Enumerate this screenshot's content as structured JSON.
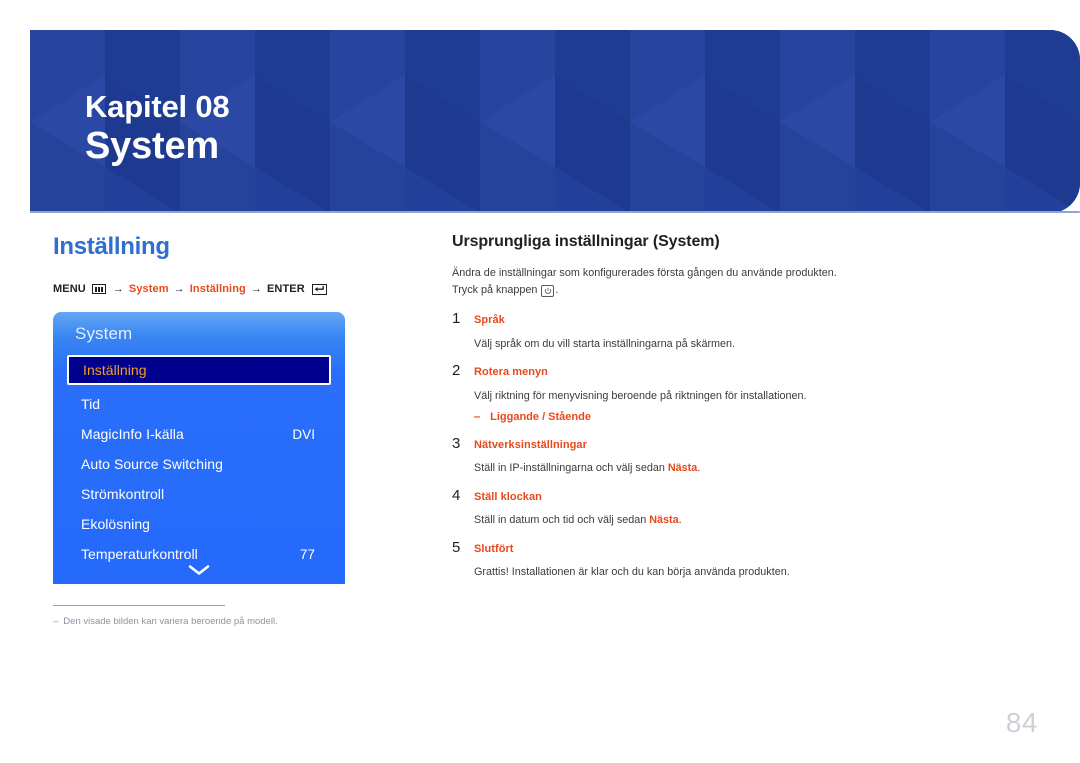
{
  "banner": {
    "kicker": "Kapitel 08",
    "title": "System",
    "bg_color": "#22409a"
  },
  "left": {
    "section_heading": "Inställning",
    "section_heading_color": "#2f6fd0",
    "menu_path": {
      "menu_label": "MENU",
      "menu_icon": "menu-grid-icon",
      "arrow": "→",
      "step1": "System",
      "step2": "Inställning",
      "enter_label": "ENTER",
      "enter_icon": "enter-return-icon",
      "highlight_color": "#e8481c"
    },
    "osd": {
      "title": "System",
      "selected_index": 0,
      "selected_bg": "#00008e",
      "selected_text_color": "#f0a022",
      "chevron_icon": "chevron-down-icon",
      "rows": [
        {
          "label": "Inställning",
          "value": "",
          "selected": true
        },
        {
          "label": "Tid",
          "value": "",
          "selected": false
        },
        {
          "label": "MagicInfo I-källa",
          "value": "DVI",
          "selected": false
        },
        {
          "label": "Auto Source Switching",
          "value": "",
          "selected": false
        },
        {
          "label": "Strömkontroll",
          "value": "",
          "selected": false
        },
        {
          "label": "Ekolösning",
          "value": "",
          "selected": false
        },
        {
          "label": "Temperaturkontroll",
          "value": "77",
          "selected": false
        }
      ]
    },
    "footnote": {
      "dash": "‒",
      "text": "Den visade bilden kan variera beroende på modell."
    }
  },
  "right": {
    "title": "Ursprungliga inställningar (System)",
    "intro_line1": "Ändra de inställningar som konfigurerades första gången du använde produkten.",
    "intro_before_icon": "Tryck på knappen ",
    "intro_icon": "power-button-icon",
    "intro_after_icon": ".",
    "steps": [
      {
        "num": "1",
        "label": "Språk",
        "desc_plain": "Välj språk om du vill starta inställningarna på skärmen.",
        "desc_pre": "Välj språk om du vill starta inställningarna på skärmen.",
        "desc_em": "",
        "desc_post": "",
        "sub": ""
      },
      {
        "num": "2",
        "label": "Rotera menyn",
        "desc_pre": "Välj riktning för menyvisning beroende på riktningen för installationen.",
        "desc_em": "",
        "desc_post": "",
        "sub": "Liggande / Stående",
        "sub_dash": "‒"
      },
      {
        "num": "3",
        "label": "Nätverksinställningar",
        "desc_pre": "Ställ in IP-inställningarna och välj sedan ",
        "desc_em": "Nästa",
        "desc_post": ".",
        "sub": ""
      },
      {
        "num": "4",
        "label": "Ställ klockan",
        "desc_pre": "Ställ in datum och tid och välj sedan ",
        "desc_em": "Nästa",
        "desc_post": ".",
        "sub": ""
      },
      {
        "num": "5",
        "label": "Slutfört",
        "desc_pre": "Grattis! Installationen är klar och du kan börja använda produkten.",
        "desc_em": "",
        "desc_post": "",
        "sub": ""
      }
    ]
  },
  "page_number": "84"
}
